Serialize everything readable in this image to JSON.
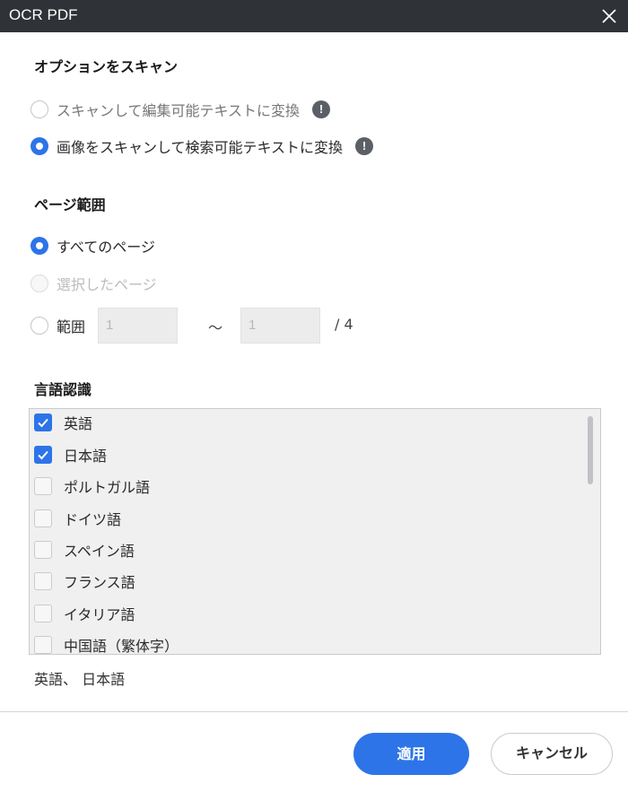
{
  "window": {
    "title": "OCR PDF"
  },
  "scan_options": {
    "heading": "オプションをスキャン",
    "options": [
      {
        "label": "スキャンして編集可能テキストに変換",
        "checked": false
      },
      {
        "label": "画像をスキャンして検索可能テキストに変換",
        "checked": true
      }
    ],
    "info_glyph": "!"
  },
  "page_range": {
    "heading": "ページ範囲",
    "all_pages": "すべてのページ",
    "selected_pages": "選択したページ",
    "range_label": "範囲",
    "range_from": "1",
    "range_separator": "～",
    "range_to": "1",
    "total_pages": "/ 4"
  },
  "language": {
    "heading": "言語認識",
    "items": [
      {
        "label": "英語",
        "checked": true
      },
      {
        "label": "日本語",
        "checked": true
      },
      {
        "label": "ポルトガル語",
        "checked": false
      },
      {
        "label": "ドイツ語",
        "checked": false
      },
      {
        "label": "スペイン語",
        "checked": false
      },
      {
        "label": "フランス語",
        "checked": false
      },
      {
        "label": "イタリア語",
        "checked": false
      },
      {
        "label": "中国語（繁体字）",
        "checked": false
      }
    ],
    "selected_summary": "英語、 日本語"
  },
  "footer": {
    "apply_label": "適用",
    "cancel_label": "キャンセル"
  },
  "colors": {
    "accent": "#2d74e8",
    "titlebar": "#2f3236"
  },
  "icons": {
    "close": "close-icon",
    "info": "info-icon",
    "check": "checkmark-icon"
  }
}
